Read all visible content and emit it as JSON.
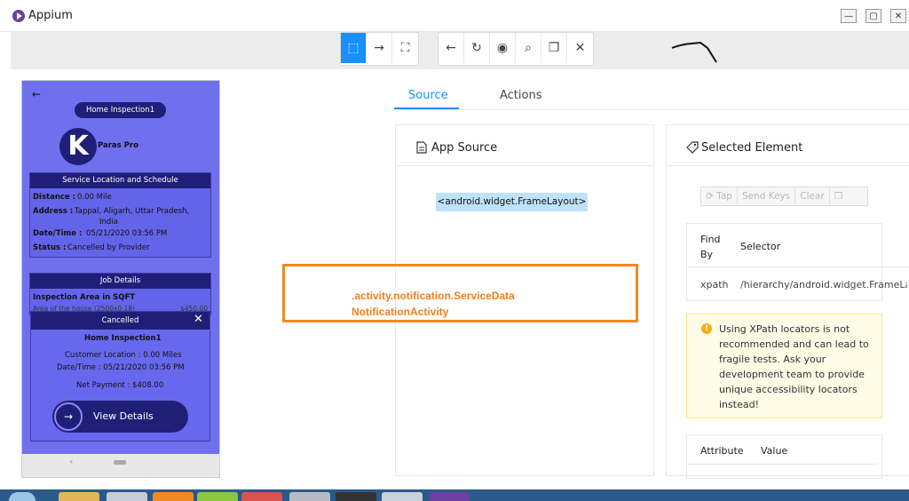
{
  "window": {
    "title": "Appium",
    "minimize": "—",
    "maximize": "▢",
    "close": "✕"
  },
  "toolbar": {
    "group1": [
      {
        "name": "select-elements-icon",
        "glyph": "⬚",
        "active": true
      },
      {
        "name": "swipe-icon",
        "glyph": "→",
        "active": false
      },
      {
        "name": "tap-by-coordinates-icon",
        "glyph": "⛶",
        "active": false
      }
    ],
    "group2": [
      {
        "name": "back-icon",
        "glyph": "←"
      },
      {
        "name": "refresh-icon",
        "glyph": "↻"
      },
      {
        "name": "eye-icon",
        "glyph": "◉"
      },
      {
        "name": "search-icon",
        "glyph": "⌕"
      },
      {
        "name": "copy-xml-icon",
        "glyph": "❐"
      },
      {
        "name": "quit-session-icon",
        "glyph": "✕"
      }
    ]
  },
  "phone": {
    "back_glyph": "←",
    "title_pill": "Home Inspection1",
    "logo_letter": "K",
    "brand": "Paras Pro",
    "service_card": {
      "header": "Service Location and Schedule",
      "distance_label": "Distance :",
      "distance_value": "0.00 Mile",
      "address_label": "Address :",
      "address_value_1": "Tappal, Aligarh, Uttar Pradesh,",
      "address_value_2": "India",
      "datetime_label": "Date/Time :",
      "datetime_value": "05/21/2020 03:56 PM",
      "status_label": "Status :",
      "status_value": "Cancelled by Provider"
    },
    "job_card": {
      "header": "Job Details",
      "area_label": "Inspection Area in SQFT",
      "area_sub": "Area of the house (2500x0.18)",
      "area_price": "$450.00"
    },
    "popup": {
      "header": "Cancelled",
      "close_glyph": "✕",
      "title": "Home Inspection1",
      "location": "Customer Location : 0.00 Miles",
      "datetime": "Date/Time : 05/21/2020 03:56 PM",
      "payment": "Net Payment : $408.00",
      "button_label": "View Details",
      "button_glyph": "→"
    },
    "nav_back_glyph": "‹"
  },
  "tabs": {
    "source": "Source",
    "actions": "Actions",
    "active": "Source"
  },
  "source_panel": {
    "icon": "file-icon",
    "title": "App Source",
    "root_node": "<android.widget.FrameLayout>"
  },
  "annotation": {
    "line1": ".activity.notification.ServiceData",
    "line2": "NotificationActivity",
    "color": "#ef7f1a"
  },
  "selected_panel": {
    "icon": "tag-icon",
    "title": "Selected Element",
    "actions": {
      "tap": "Tap",
      "send_keys": "Send Keys",
      "clear": "Clear"
    },
    "selector_table": {
      "header_find_by_1": "Find",
      "header_find_by_2": "By",
      "header_selector": "Selector",
      "row_find_by": "xpath",
      "row_selector": "/hierarchy/android.widget.FrameLay"
    },
    "warning": "Using XPath locators is not recommended and can lead to fragile tests. Ask your development team to provide unique accessibility locators instead!",
    "warning_icon": "!",
    "attr_table": {
      "attribute": "Attribute",
      "value": "Value"
    }
  },
  "colors": {
    "accent": "#1890ff",
    "phone_bg": "#7070ef",
    "phone_dark": "#1f1f78",
    "warning_bg": "#fffbe6"
  }
}
